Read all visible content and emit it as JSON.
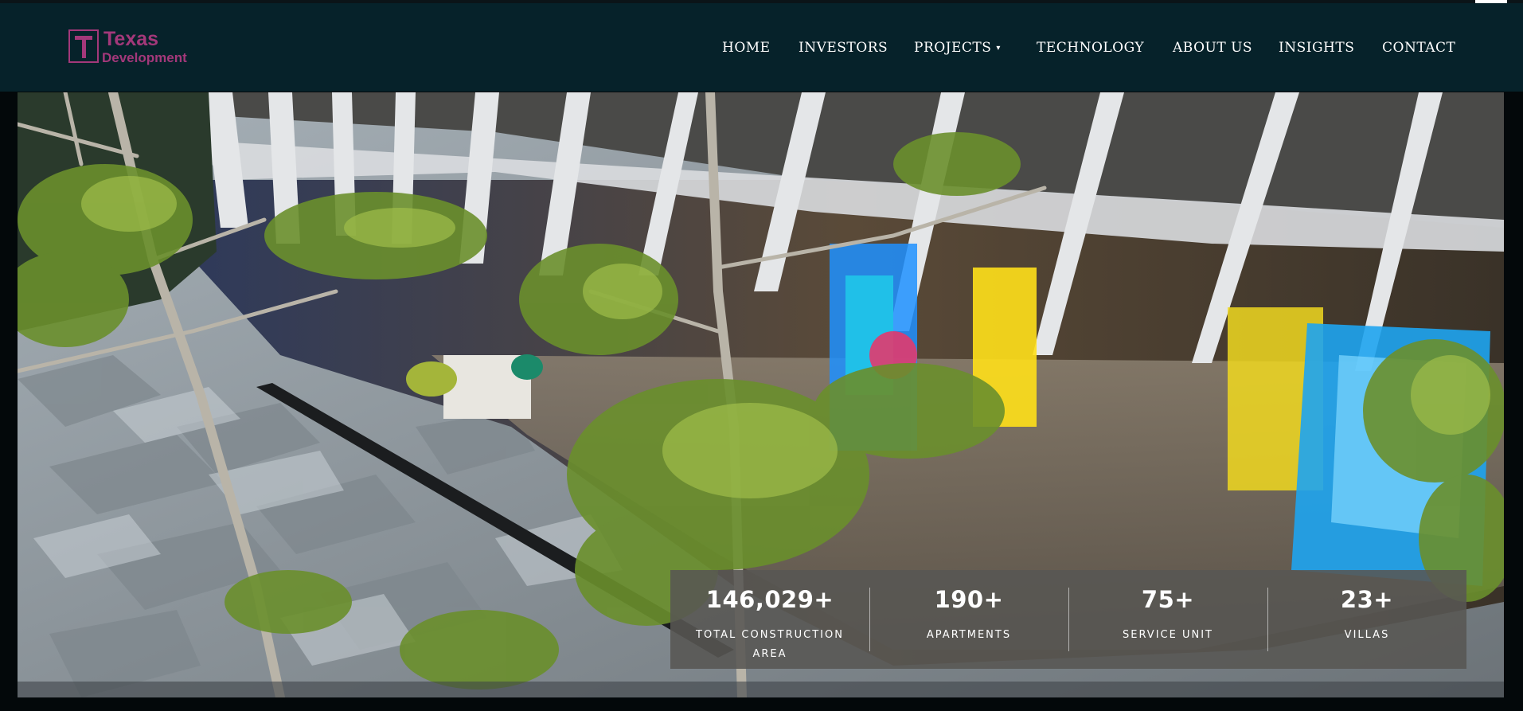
{
  "brand": {
    "line1": "Texas",
    "line2": "Development",
    "color": "#a3387a"
  },
  "nav": {
    "home": "HOME",
    "investors": "INVESTORS",
    "projects": "PROJECTS",
    "projects_caret": "▾",
    "technology": "TECHNOLOGY",
    "about": "ABOUT US",
    "insights": "INSIGHTS",
    "contact": "CONTACT"
  },
  "hero": {
    "image": "building-courtyard-trees-glass-facade"
  },
  "stats": [
    {
      "value": "146,029+",
      "label": "TOTAL CONSTRUCTION AREA"
    },
    {
      "value": "190+",
      "label": "APARTMENTS"
    },
    {
      "value": "75+",
      "label": "SERVICE UNIT"
    },
    {
      "value": "23+",
      "label": "VILLAS"
    }
  ],
  "colors": {
    "header_bg": "#06222a",
    "page_bg": "#03080a",
    "stats_bg": "#585653"
  }
}
